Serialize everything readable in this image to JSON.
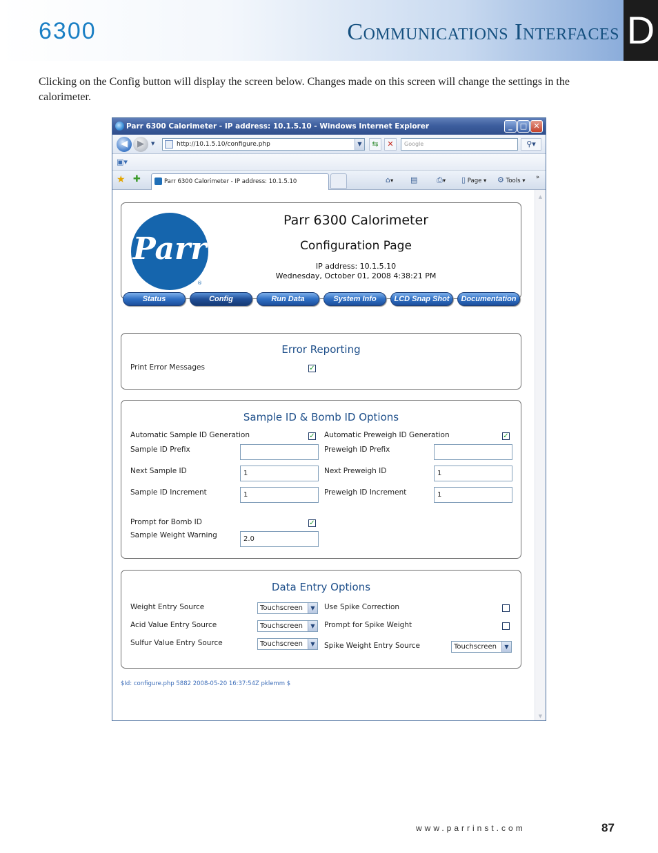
{
  "header": {
    "model": "6300",
    "chapter_title": "Communications Interfaces",
    "chapter_letter": "D"
  },
  "intro_text": "Clicking on the Config button will display the screen below. Changes made on this screen will change the settings in the calorimeter.",
  "browser": {
    "window_title": "Parr 6300 Calorimeter - IP address: 10.1.5.10 - Windows Internet Explorer",
    "address_url": "http://10.1.5.10/configure.php",
    "search_placeholder": "Google",
    "tab_title": "Parr 6300 Calorimeter - IP address: 10.1.5.10",
    "command_page": "Page",
    "command_tools": "Tools"
  },
  "page": {
    "logo_text": "Parr",
    "app_title": "Parr 6300 Calorimeter",
    "page_subtitle": "Configuration Page",
    "ip_line": "IP address: 10.1.5.10",
    "datetime_line": "Wednesday, October 01, 2008 4:38:21 PM",
    "nav": [
      "Status",
      "Config",
      "Run Data",
      "System Info",
      "LCD Snap Shot",
      "Documentation"
    ],
    "active_nav": "Config",
    "error_reporting": {
      "title": "Error Reporting",
      "print_error_messages_label": "Print Error Messages",
      "print_error_messages_checked": true
    },
    "sample_options": {
      "title": "Sample ID & Bomb ID Options",
      "auto_sample_id_label": "Automatic Sample ID Generation",
      "auto_sample_id_checked": true,
      "auto_preweigh_id_label": "Automatic Preweigh ID Generation",
      "auto_preweigh_id_checked": true,
      "sample_id_prefix_label": "Sample ID Prefix",
      "sample_id_prefix_value": "",
      "preweigh_id_prefix_label": "Preweigh ID Prefix",
      "preweigh_id_prefix_value": "",
      "next_sample_id_label": "Next Sample ID",
      "next_sample_id_value": "1",
      "next_preweigh_id_label": "Next Preweigh ID",
      "next_preweigh_id_value": "1",
      "sample_id_increment_label": "Sample ID Increment",
      "sample_id_increment_value": "1",
      "preweigh_id_increment_label": "Preweigh ID Increment",
      "preweigh_id_increment_value": "1",
      "prompt_bomb_id_label": "Prompt for Bomb ID",
      "prompt_bomb_id_checked": true,
      "sample_weight_warning_label": "Sample Weight Warning",
      "sample_weight_warning_value": "2.0"
    },
    "data_entry": {
      "title": "Data Entry Options",
      "weight_entry_source_label": "Weight Entry Source",
      "weight_entry_source_value": "Touchscreen",
      "acid_value_entry_source_label": "Acid Value Entry Source",
      "acid_value_entry_source_value": "Touchscreen",
      "sulfur_value_entry_source_label": "Sulfur Value Entry Source",
      "sulfur_value_entry_source_value": "Touchscreen",
      "use_spike_correction_label": "Use Spike Correction",
      "use_spike_correction_checked": false,
      "prompt_spike_weight_label": "Prompt for Spike Weight",
      "prompt_spike_weight_checked": false,
      "spike_weight_entry_source_label": "Spike Weight Entry Source",
      "spike_weight_entry_source_value": "Touchscreen"
    },
    "svn_id": "$Id: configure.php 5882 2008-05-20 16:37:54Z pklemm $"
  },
  "footer": {
    "website": "www.parrinst.com",
    "page_number": "87"
  },
  "colors": {
    "accent_blue": "#1a7fc4",
    "panel_title_blue": "#1e4f8a",
    "nav_button_blue": "#2f6fc4",
    "checkbox_green": "#1e9a2e"
  }
}
